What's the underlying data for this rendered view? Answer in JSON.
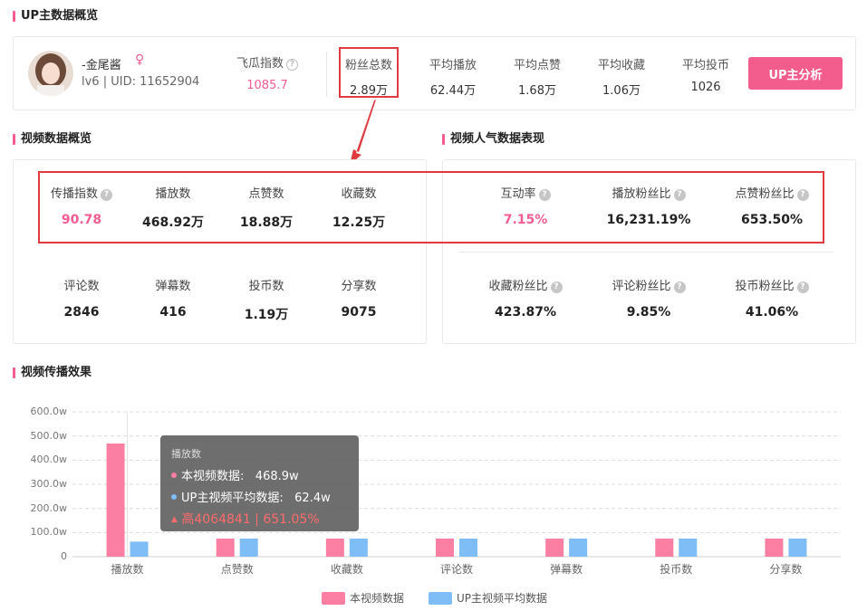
{
  "overview": {
    "title": "UP主数据概览"
  },
  "up": {
    "name": "-金尾酱",
    "meta": "lv6 | UID: 11652904",
    "gender_icon": "female-icon",
    "feigua_label": "飞瓜指数",
    "feigua_value": "1085.7",
    "stats": [
      {
        "label": "粉丝总数",
        "value": "2.89万"
      },
      {
        "label": "平均播放",
        "value": "62.44万"
      },
      {
        "label": "平均点赞",
        "value": "1.68万"
      },
      {
        "label": "平均收藏",
        "value": "1.06万"
      },
      {
        "label": "平均投币",
        "value": "1026"
      }
    ],
    "button_label": "UP主分析"
  },
  "video_overview": {
    "title": "视频数据概览",
    "row1": [
      {
        "label": "传播指数",
        "value": "90.78",
        "help": true
      },
      {
        "label": "播放数",
        "value": "468.92万"
      },
      {
        "label": "点赞数",
        "value": "18.88万"
      },
      {
        "label": "收藏数",
        "value": "12.25万"
      }
    ],
    "row2": [
      {
        "label": "评论数",
        "value": "2846"
      },
      {
        "label": "弹幕数",
        "value": "416"
      },
      {
        "label": "投币数",
        "value": "1.19万"
      },
      {
        "label": "分享数",
        "value": "9075"
      }
    ]
  },
  "popularity": {
    "title": "视频人气数据表现",
    "row1": [
      {
        "label": "互动率",
        "value": "7.15%"
      },
      {
        "label": "播放粉丝比",
        "value": "16,231.19%"
      },
      {
        "label": "点赞粉丝比",
        "value": "653.50%"
      }
    ],
    "row2": [
      {
        "label": "收藏粉丝比",
        "value": "423.87%"
      },
      {
        "label": "评论粉丝比",
        "value": "9.85%"
      },
      {
        "label": "投币粉丝比",
        "value": "41.06%"
      }
    ]
  },
  "spread": {
    "title": "视频传播效果"
  },
  "chart_data": {
    "type": "bar",
    "categories": [
      "播放数",
      "点赞数",
      "收藏数",
      "评论数",
      "弹幕数",
      "投币数",
      "分享数"
    ],
    "series": [
      {
        "name": "本视频数据",
        "color": "#fb7fa3",
        "values": [
          468.9,
          75,
          75,
          75,
          75,
          75,
          75
        ]
      },
      {
        "name": "UP主视频平均数据",
        "color": "#7fbdf7",
        "values": [
          62.4,
          75,
          75,
          75,
          75,
          75,
          75
        ]
      }
    ],
    "y_ticks": [
      "0",
      "100.0w",
      "200.0w",
      "300.0w",
      "400.0w",
      "500.0w",
      "600.0w"
    ],
    "ylim": [
      0,
      600
    ],
    "grid": true,
    "legend": "bottom-center",
    "tooltip": {
      "title": "播放数",
      "row1_label": "本视频数据:",
      "row1_value": "468.9w",
      "row2_label": "UP主视频平均数据:",
      "row2_value": "62.4w",
      "diff": "高4064841 | 651.05%"
    }
  }
}
